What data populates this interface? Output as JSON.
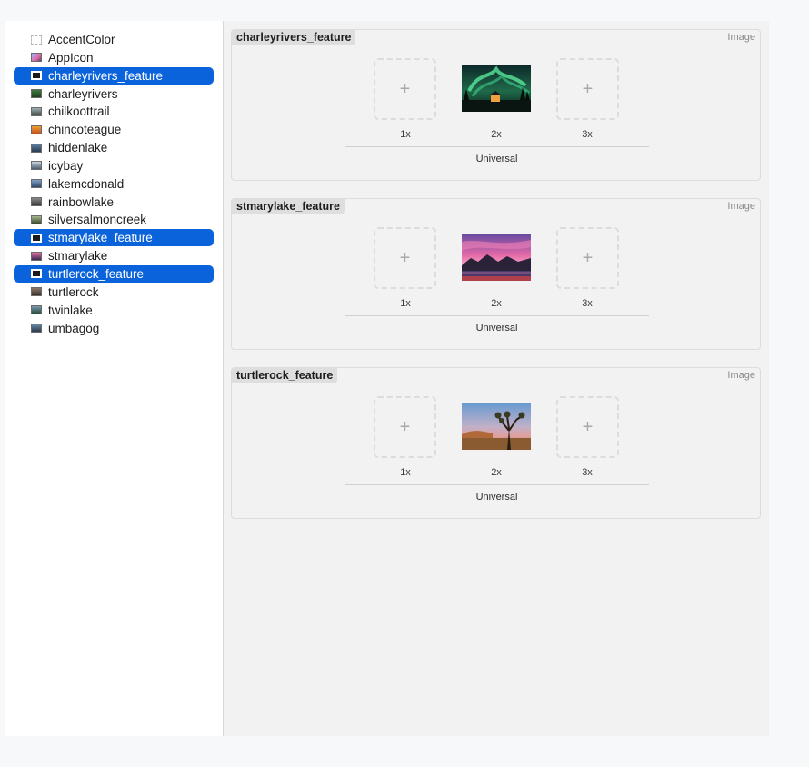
{
  "sidebar": {
    "items": [
      {
        "label": "AccentColor",
        "icon": "color-set-icon",
        "selected": false
      },
      {
        "label": "AppIcon",
        "icon": "app-icon-set-icon",
        "selected": false
      },
      {
        "label": "charleyrivers_feature",
        "icon": "image-set-icon",
        "selected": true
      },
      {
        "label": "charleyrivers",
        "icon": "image-set-icon",
        "selected": false
      },
      {
        "label": "chilkoottrail",
        "icon": "image-set-icon",
        "selected": false
      },
      {
        "label": "chincoteague",
        "icon": "image-set-icon",
        "selected": false
      },
      {
        "label": "hiddenlake",
        "icon": "image-set-icon",
        "selected": false
      },
      {
        "label": "icybay",
        "icon": "image-set-icon",
        "selected": false
      },
      {
        "label": "lakemcdonald",
        "icon": "image-set-icon",
        "selected": false
      },
      {
        "label": "rainbowlake",
        "icon": "image-set-icon",
        "selected": false
      },
      {
        "label": "silversalmoncreek",
        "icon": "image-set-icon",
        "selected": false
      },
      {
        "label": "stmarylake_feature",
        "icon": "image-set-icon",
        "selected": true
      },
      {
        "label": "stmarylake",
        "icon": "image-set-icon",
        "selected": false
      },
      {
        "label": "turtlerock_feature",
        "icon": "image-set-icon",
        "selected": true
      },
      {
        "label": "turtlerock",
        "icon": "image-set-icon",
        "selected": false
      },
      {
        "label": "twinlake",
        "icon": "image-set-icon",
        "selected": false
      },
      {
        "label": "umbagog",
        "icon": "image-set-icon",
        "selected": false
      }
    ]
  },
  "cards": [
    {
      "title": "charleyrivers_feature",
      "type": "Image",
      "slots": [
        "1x",
        "2x",
        "3x"
      ],
      "add_symbol": "+",
      "idiom": "Universal",
      "thumbnail": "aurora-night-cabin-photo"
    },
    {
      "title": "stmarylake_feature",
      "type": "Image",
      "slots": [
        "1x",
        "2x",
        "3x"
      ],
      "add_symbol": "+",
      "idiom": "Universal",
      "thumbnail": "pink-sunset-lake-photo"
    },
    {
      "title": "turtlerock_feature",
      "type": "Image",
      "slots": [
        "1x",
        "2x",
        "3x"
      ],
      "add_symbol": "+",
      "idiom": "Universal",
      "thumbnail": "joshua-tree-desert-photo"
    }
  ]
}
